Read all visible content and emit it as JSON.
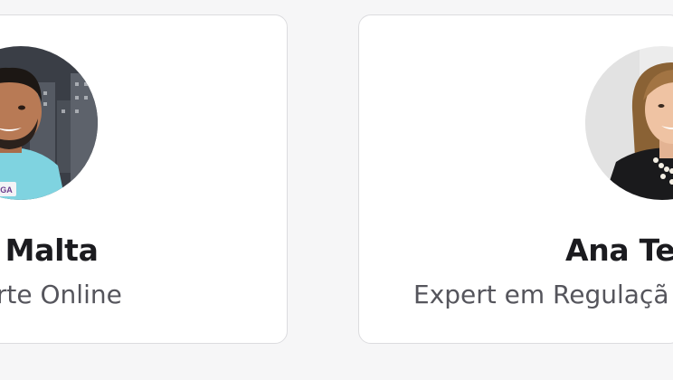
{
  "speakers": [
    {
      "name_visible": "io Malta",
      "role_visible": "Sorte Online",
      "shirt_text": "JOGA"
    },
    {
      "name_visible": "Ana Tei",
      "role_visible": "Expert em Regulaçã"
    }
  ],
  "colors": {
    "page_background": "#f6f6f7",
    "card_background": "#ffffff",
    "card_border": "#dcdcdf",
    "name_text": "#1b1b1f",
    "role_text": "#55555c",
    "shirt_color": "#7fd3e0"
  }
}
